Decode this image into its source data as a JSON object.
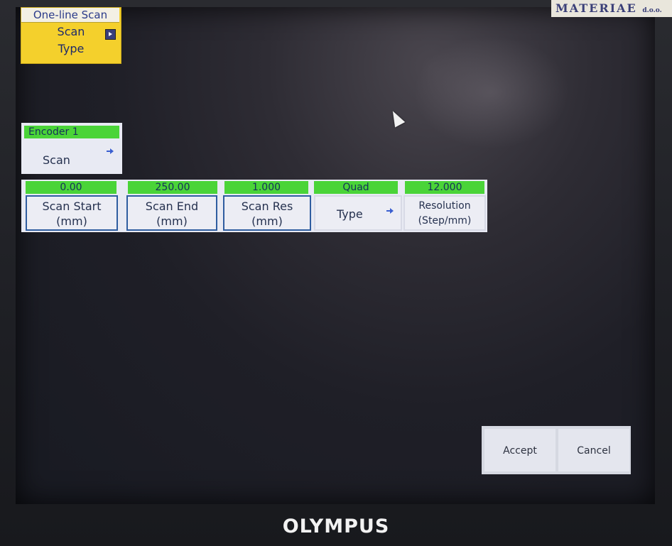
{
  "scan_mode": {
    "title": "One-line Scan",
    "label_line1": "Scan",
    "label_line2": "Type"
  },
  "encoder": {
    "value": "Encoder 1",
    "label": "Scan"
  },
  "params": [
    {
      "value": "0.00",
      "label_line1": "Scan Start",
      "label_line2": "(mm)"
    },
    {
      "value": "250.00",
      "label_line1": "Scan End",
      "label_line2": "(mm)"
    },
    {
      "value": "1.000",
      "label_line1": "Scan Res",
      "label_line2": "(mm)"
    },
    {
      "value": "Quad",
      "label_line1": "Type",
      "label_line2": ""
    },
    {
      "value": "12.000",
      "label_line1": "Resolution",
      "label_line2": "(Step/mm)"
    }
  ],
  "actions": {
    "accept_label": "Accept",
    "cancel_label": "Cancel"
  },
  "branding": {
    "sticker": "MATERIAE",
    "sticker_suffix": "d.o.o.",
    "brand": "OLYMPUS"
  },
  "colors": {
    "value_green": "#4ad438",
    "mode_yellow": "#f4d02c",
    "button_border_blue": "#2f5da0"
  }
}
